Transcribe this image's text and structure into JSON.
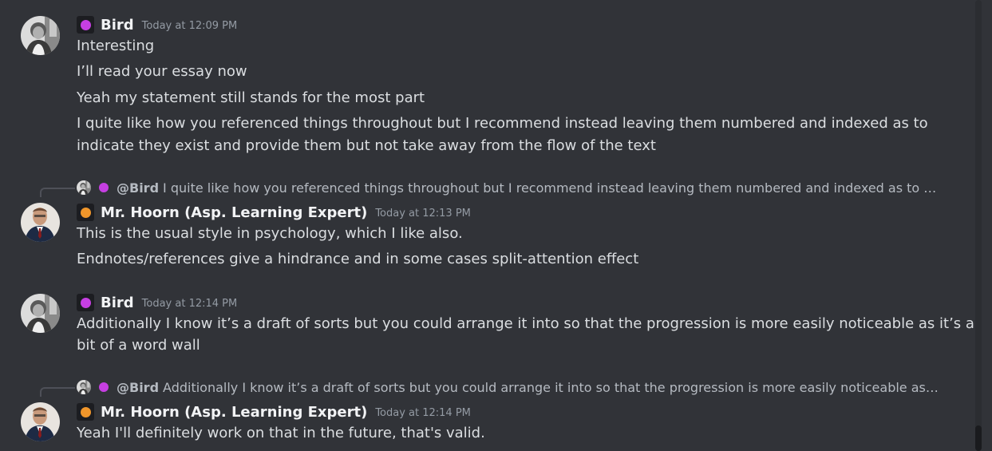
{
  "messages": [
    {
      "user": "Bird",
      "role_color": "#c63fe2",
      "timestamp": "Today at 12:09 PM",
      "lines": [
        "Interesting",
        "I’ll read your essay now",
        "Yeah my statement still stands for the most part",
        "I quite like how you referenced things throughout but I recommend instead leaving them numbered and indexed as to",
        "indicate they exist and provide them but not take away from the flow of the text"
      ]
    },
    {
      "reply": {
        "mention": "@Bird",
        "text": "I quite like how you referenced things throughout but I recommend instead leaving them numbered and indexed as to indicate t..."
      },
      "user": "Mr. Hoorn (Asp. Learning Expert)",
      "role_color": "#f0962b",
      "timestamp": "Today at 12:13 PM",
      "lines": [
        "This is the usual style in psychology, which I like also.",
        "Endnotes/references give a hindrance and in some cases split-attention effect"
      ]
    },
    {
      "user": "Bird",
      "role_color": "#c63fe2",
      "timestamp": "Today at 12:14 PM",
      "lines": [
        "Additionally I know it’s a draft of sorts but you could arrange it into so that the progression is more easily noticeable as it’s a",
        "bit of a word wall"
      ]
    },
    {
      "reply": {
        "mention": "@Bird",
        "text": "Additionally I know it’s a draft of sorts but you could arrange it into so that the progression is more easily noticeable as it’s a bit ..."
      },
      "user": "Mr. Hoorn (Asp. Learning Expert)",
      "role_color": "#f0962b",
      "timestamp": "Today at 12:14 PM",
      "lines": [
        "Yeah I'll definitely work on that in the future, that's valid."
      ]
    }
  ],
  "icons": {
    "bird_avatar": "avatar-bird-icon",
    "hoorn_avatar": "avatar-hoorn-icon",
    "role_badge": "role-badge-icon"
  }
}
